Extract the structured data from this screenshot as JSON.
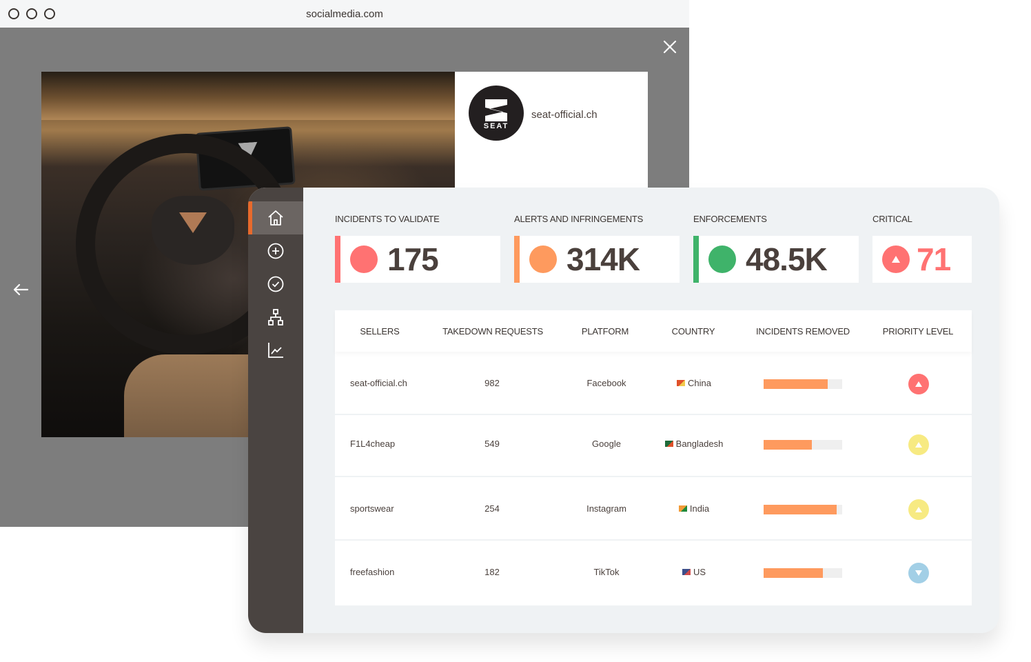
{
  "browser": {
    "url": "socialmedia.com",
    "close_icon": "close-icon",
    "back_icon": "arrow-left-icon"
  },
  "post": {
    "image_description": "Car interior with steering wheel and dashboard display",
    "account_handle": "seat-official.ch",
    "avatar_text": "SEAT"
  },
  "sidebar": {
    "items": [
      {
        "icon": "home-icon",
        "active": true
      },
      {
        "icon": "plus-circle-icon",
        "active": false
      },
      {
        "icon": "check-circle-icon",
        "active": false
      },
      {
        "icon": "hierarchy-icon",
        "active": false
      },
      {
        "icon": "line-chart-icon",
        "active": false
      }
    ]
  },
  "kpis": [
    {
      "label": "INCIDENTS TO VALIDATE",
      "value": "175",
      "color": "#ff7272"
    },
    {
      "label": "ALERTS AND INFRINGEMENTS",
      "value": "314K",
      "color": "#fe9a5e"
    },
    {
      "label": "ENFORCEMENTS",
      "value": "48.5K",
      "color": "#3fb36a"
    },
    {
      "label": "CRITICAL",
      "value": "71",
      "color": "#ff7272",
      "icon": "triangle-up-icon"
    }
  ],
  "table": {
    "columns": [
      "SELLERS",
      "TAKEDOWN REQUESTS",
      "PLATFORM",
      "COUNTRY",
      "INCIDENTS REMOVED",
      "PRIORITY LEVEL"
    ],
    "rows": [
      {
        "seller": "seat-official.ch",
        "takedown_requests": "982",
        "platform": "Facebook",
        "country": "China",
        "flag_colors": [
          "#e0502a",
          "#f2c94c"
        ],
        "incidents_removed_fraction": 0.82,
        "priority": "high",
        "priority_color": "#ff7272",
        "priority_icon": "triangle-up-icon"
      },
      {
        "seller": "F1L4cheap",
        "takedown_requests": "549",
        "platform": "Google",
        "country": "Bangladesh",
        "flag_colors": [
          "#1f6b3a",
          "#e0502a"
        ],
        "incidents_removed_fraction": 0.61,
        "priority": "medium",
        "priority_color": "#f7ea82",
        "priority_icon": "triangle-up-icon"
      },
      {
        "seller": "sportswear",
        "takedown_requests": "254",
        "platform": "Instagram",
        "country": "India",
        "flag_colors": [
          "#f29b38",
          "#1f8a3a"
        ],
        "incidents_removed_fraction": 0.93,
        "priority": "medium",
        "priority_color": "#f7ea82",
        "priority_icon": "triangle-up-icon"
      },
      {
        "seller": "freefashion",
        "takedown_requests": "182",
        "platform": "TikTok",
        "country": "US",
        "flag_colors": [
          "#3c4f8a",
          "#d04a4a"
        ],
        "incidents_removed_fraction": 0.75,
        "priority": "low",
        "priority_color": "#a2cfe6",
        "priority_icon": "triangle-down-icon"
      }
    ]
  }
}
